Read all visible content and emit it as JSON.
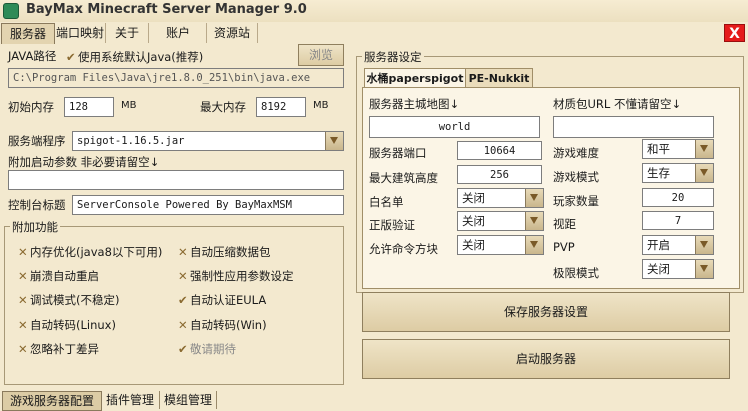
{
  "window": {
    "title": "BayMax Minecraft Server Manager 9.0",
    "close_label": "X"
  },
  "menu": [
    "服务器",
    "端口映射",
    "关于",
    "账户",
    "资源站"
  ],
  "java": {
    "label": "JAVA路径",
    "use_system_check": "✔",
    "use_system_label": "使用系统默认Java(推荐)",
    "browse": "浏览",
    "path": "C:\\Program Files\\Java\\jre1.8.0_251\\bin\\java.exe"
  },
  "memory": {
    "init_label": "初始内存",
    "init_value": "128",
    "init_unit": "MB",
    "max_label": "最大内存",
    "max_value": "8192",
    "max_unit": "MB"
  },
  "server_program": {
    "label": "服务端程序",
    "value": "spigot-1.16.5.jar"
  },
  "extra_args": {
    "label": "附加启动参数 非必要请留空↓",
    "value": ""
  },
  "console_title": {
    "label": "控制台标题",
    "value": "ServerConsole Powered By BayMaxMSM"
  },
  "addons": {
    "title": "附加功能",
    "items": [
      {
        "mark": "✕",
        "label": "内存优化(java8以下可用)"
      },
      {
        "mark": "✕",
        "label": "自动压缩数据包"
      },
      {
        "mark": "✕",
        "label": "崩溃自动重启"
      },
      {
        "mark": "✕",
        "label": "强制性应用参数设定"
      },
      {
        "mark": "✕",
        "label": "调试模式(不稳定)"
      },
      {
        "mark": "✔",
        "label": "自动认证EULA"
      },
      {
        "mark": "✕",
        "label": "自动转码(Linux)"
      },
      {
        "mark": "✕",
        "label": "自动转码(Win)"
      },
      {
        "mark": "✕",
        "label": "忽略补丁差异"
      },
      {
        "mark": "✔",
        "label": "敬请期待"
      }
    ]
  },
  "settings": {
    "title": "服务器设定",
    "tabs": [
      "水桶paperspigot",
      "PE-Nukkit"
    ],
    "main_map_label": "服务器主城地图↓",
    "main_map_value": "world",
    "resource_pack_label": "材质包URL 不懂请留空↓",
    "resource_pack_value": "",
    "port_label": "服务器端口",
    "port_value": "10664",
    "build_height_label": "最大建筑高度",
    "build_height_value": "256",
    "whitelist_label": "白名单",
    "whitelist_value": "关闭",
    "online_mode_label": "正版验证",
    "online_mode_value": "关闭",
    "command_block_label": "允许命令方块",
    "command_block_value": "关闭",
    "difficulty_label": "游戏难度",
    "difficulty_value": "和平",
    "gamemode_label": "游戏模式",
    "gamemode_value": "生存",
    "players_label": "玩家数量",
    "players_value": "20",
    "view_distance_label": "视距",
    "view_distance_value": "7",
    "pvp_label": "PVP",
    "pvp_value": "开启",
    "hardcore_label": "极限模式",
    "hardcore_value": "关闭",
    "save_button": "保存服务器设置",
    "start_button": "启动服务器"
  },
  "bottom_tabs": [
    "游戏服务器配置",
    "插件管理",
    "模组管理"
  ],
  "colors": {
    "background": "#f3e9cf",
    "close": "#e51b1b",
    "mark": "#8a6a30"
  }
}
